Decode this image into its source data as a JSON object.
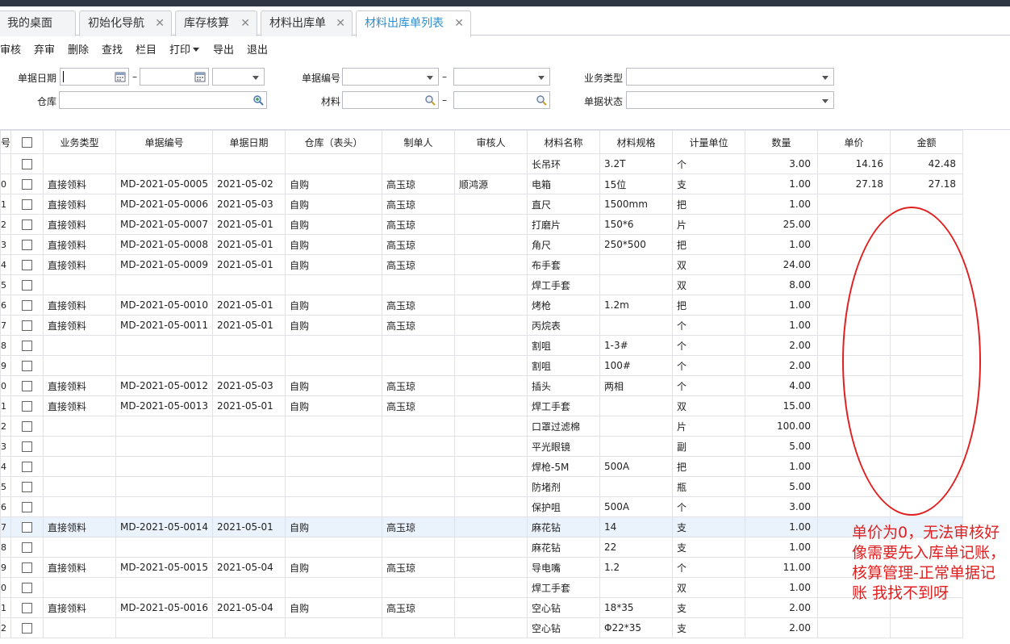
{
  "tabs": [
    {
      "label": "我的桌面",
      "closable": false
    },
    {
      "label": "初始化导航",
      "closable": true
    },
    {
      "label": "库存核算",
      "closable": true
    },
    {
      "label": "材料出库单",
      "closable": true
    },
    {
      "label": "材料出库单列表",
      "closable": true,
      "active": true
    }
  ],
  "toolbar": {
    "audit": "审核",
    "unaudit": "弃审",
    "delete": "删除",
    "find": "查找",
    "columns": "栏目",
    "print": "打印",
    "export": "导出",
    "exit": "退出"
  },
  "filters": {
    "doc_date": "单据日期",
    "doc_no": "单据编号",
    "biz_type": "业务类型",
    "warehouse": "仓库",
    "material": "材料",
    "doc_status": "单据状态",
    "dash": "–"
  },
  "table": {
    "headers": [
      "号",
      "",
      "业务类型",
      "单据编号",
      "单据日期",
      "仓库（表头）",
      "制单人",
      "审核人",
      "材料名称",
      "材料规格",
      "计量单位",
      "数量",
      "单价",
      "金额"
    ],
    "rows": [
      {
        "idx": "",
        "biz": "",
        "no": "",
        "date": "",
        "wh": "",
        "maker": "",
        "auditor": "",
        "mat": "长吊环",
        "spec": "3.2T",
        "unit": "个",
        "qty": "3.00",
        "price": "14.16",
        "amount": "42.48"
      },
      {
        "idx": "0",
        "biz": "直接领料",
        "no": "MD-2021-05-0005",
        "date": "2021-05-02",
        "wh": "自购",
        "maker": "高玉琼",
        "auditor": "顺鸿源",
        "mat": "电箱",
        "spec": "15位",
        "unit": "支",
        "qty": "1.00",
        "price": "27.18",
        "amount": "27.18"
      },
      {
        "idx": "1",
        "biz": "直接领料",
        "no": "MD-2021-05-0006",
        "date": "2021-05-03",
        "wh": "自购",
        "maker": "高玉琼",
        "auditor": "",
        "mat": "直尺",
        "spec": "1500mm",
        "unit": "把",
        "qty": "1.00",
        "price": "",
        "amount": ""
      },
      {
        "idx": "2",
        "biz": "直接领料",
        "no": "MD-2021-05-0007",
        "date": "2021-05-01",
        "wh": "自购",
        "maker": "高玉琼",
        "auditor": "",
        "mat": "打磨片",
        "spec": "150*6",
        "unit": "片",
        "qty": "25.00",
        "price": "",
        "amount": ""
      },
      {
        "idx": "3",
        "biz": "直接领料",
        "no": "MD-2021-05-0008",
        "date": "2021-05-01",
        "wh": "自购",
        "maker": "高玉琼",
        "auditor": "",
        "mat": "角尺",
        "spec": "250*500",
        "unit": "把",
        "qty": "1.00",
        "price": "",
        "amount": ""
      },
      {
        "idx": "4",
        "biz": "直接领料",
        "no": "MD-2021-05-0009",
        "date": "2021-05-01",
        "wh": "自购",
        "maker": "高玉琼",
        "auditor": "",
        "mat": "布手套",
        "spec": "",
        "unit": "双",
        "qty": "24.00",
        "price": "",
        "amount": ""
      },
      {
        "idx": "5",
        "biz": "",
        "no": "",
        "date": "",
        "wh": "",
        "maker": "",
        "auditor": "",
        "mat": "焊工手套",
        "spec": "",
        "unit": "双",
        "qty": "8.00",
        "price": "",
        "amount": ""
      },
      {
        "idx": "6",
        "biz": "直接领料",
        "no": "MD-2021-05-0010",
        "date": "2021-05-01",
        "wh": "自购",
        "maker": "高玉琼",
        "auditor": "",
        "mat": "烤枪",
        "spec": "1.2m",
        "unit": "把",
        "qty": "1.00",
        "price": "",
        "amount": ""
      },
      {
        "idx": "7",
        "biz": "直接领料",
        "no": "MD-2021-05-0011",
        "date": "2021-05-01",
        "wh": "自购",
        "maker": "高玉琼",
        "auditor": "",
        "mat": "丙烷表",
        "spec": "",
        "unit": "个",
        "qty": "1.00",
        "price": "",
        "amount": ""
      },
      {
        "idx": "8",
        "biz": "",
        "no": "",
        "date": "",
        "wh": "",
        "maker": "",
        "auditor": "",
        "mat": "割咀",
        "spec": "1-3#",
        "unit": "个",
        "qty": "2.00",
        "price": "",
        "amount": ""
      },
      {
        "idx": "9",
        "biz": "",
        "no": "",
        "date": "",
        "wh": "",
        "maker": "",
        "auditor": "",
        "mat": "割咀",
        "spec": "100#",
        "unit": "个",
        "qty": "2.00",
        "price": "",
        "amount": ""
      },
      {
        "idx": "0",
        "biz": "直接领料",
        "no": "MD-2021-05-0012",
        "date": "2021-05-03",
        "wh": "自购",
        "maker": "高玉琼",
        "auditor": "",
        "mat": "插头",
        "spec": "两相",
        "unit": "个",
        "qty": "4.00",
        "price": "",
        "amount": ""
      },
      {
        "idx": "1",
        "biz": "直接领料",
        "no": "MD-2021-05-0013",
        "date": "2021-05-01",
        "wh": "自购",
        "maker": "高玉琼",
        "auditor": "",
        "mat": "焊工手套",
        "spec": "",
        "unit": "双",
        "qty": "15.00",
        "price": "",
        "amount": ""
      },
      {
        "idx": "2",
        "biz": "",
        "no": "",
        "date": "",
        "wh": "",
        "maker": "",
        "auditor": "",
        "mat": "口罩过滤棉",
        "spec": "",
        "unit": "片",
        "qty": "100.00",
        "price": "",
        "amount": ""
      },
      {
        "idx": "3",
        "biz": "",
        "no": "",
        "date": "",
        "wh": "",
        "maker": "",
        "auditor": "",
        "mat": "平光眼镜",
        "spec": "",
        "unit": "副",
        "qty": "5.00",
        "price": "",
        "amount": ""
      },
      {
        "idx": "4",
        "biz": "",
        "no": "",
        "date": "",
        "wh": "",
        "maker": "",
        "auditor": "",
        "mat": "焊枪-5M",
        "spec": "500A",
        "unit": "把",
        "qty": "1.00",
        "price": "",
        "amount": ""
      },
      {
        "idx": "5",
        "biz": "",
        "no": "",
        "date": "",
        "wh": "",
        "maker": "",
        "auditor": "",
        "mat": "防堵剂",
        "spec": "",
        "unit": "瓶",
        "qty": "5.00",
        "price": "",
        "amount": ""
      },
      {
        "idx": "6",
        "biz": "",
        "no": "",
        "date": "",
        "wh": "",
        "maker": "",
        "auditor": "",
        "mat": "保护咀",
        "spec": "500A",
        "unit": "个",
        "qty": "3.00",
        "price": "",
        "amount": ""
      },
      {
        "idx": "7",
        "biz": "直接领料",
        "no": "MD-2021-05-0014",
        "date": "2021-05-01",
        "wh": "自购",
        "maker": "高玉琼",
        "auditor": "",
        "mat": "麻花钻",
        "spec": "14",
        "unit": "支",
        "qty": "1.00",
        "price": "",
        "amount": "",
        "highlight": true
      },
      {
        "idx": "8",
        "biz": "",
        "no": "",
        "date": "",
        "wh": "",
        "maker": "",
        "auditor": "",
        "mat": "麻花钻",
        "spec": "22",
        "unit": "支",
        "qty": "1.00",
        "price": "",
        "amount": ""
      },
      {
        "idx": "9",
        "biz": "直接领料",
        "no": "MD-2021-05-0015",
        "date": "2021-05-04",
        "wh": "自购",
        "maker": "高玉琼",
        "auditor": "",
        "mat": "导电嘴",
        "spec": "1.2",
        "unit": "个",
        "qty": "11.00",
        "price": "",
        "amount": ""
      },
      {
        "idx": "0",
        "biz": "",
        "no": "",
        "date": "",
        "wh": "",
        "maker": "",
        "auditor": "",
        "mat": "焊工手套",
        "spec": "",
        "unit": "双",
        "qty": "1.00",
        "price": "",
        "amount": ""
      },
      {
        "idx": "1",
        "biz": "直接领料",
        "no": "MD-2021-05-0016",
        "date": "2021-05-04",
        "wh": "自购",
        "maker": "高玉琼",
        "auditor": "",
        "mat": "空心钻",
        "spec": "18*35",
        "unit": "支",
        "qty": "2.00",
        "price": "",
        "amount": ""
      },
      {
        "idx": "2",
        "biz": "",
        "no": "",
        "date": "",
        "wh": "",
        "maker": "",
        "auditor": "",
        "mat": "空心钻",
        "spec": "Φ22*35",
        "unit": "支",
        "qty": "2.00",
        "price": "",
        "amount": ""
      }
    ]
  },
  "note": "单价为0，无法审核好像需要先入库单记账，核算管理-正常单据记账  我找不到呀",
  "colors": {
    "accent_tab": "#2a8fd0",
    "annotation": "#e02020",
    "highlight_row": "#eaf2fb"
  }
}
